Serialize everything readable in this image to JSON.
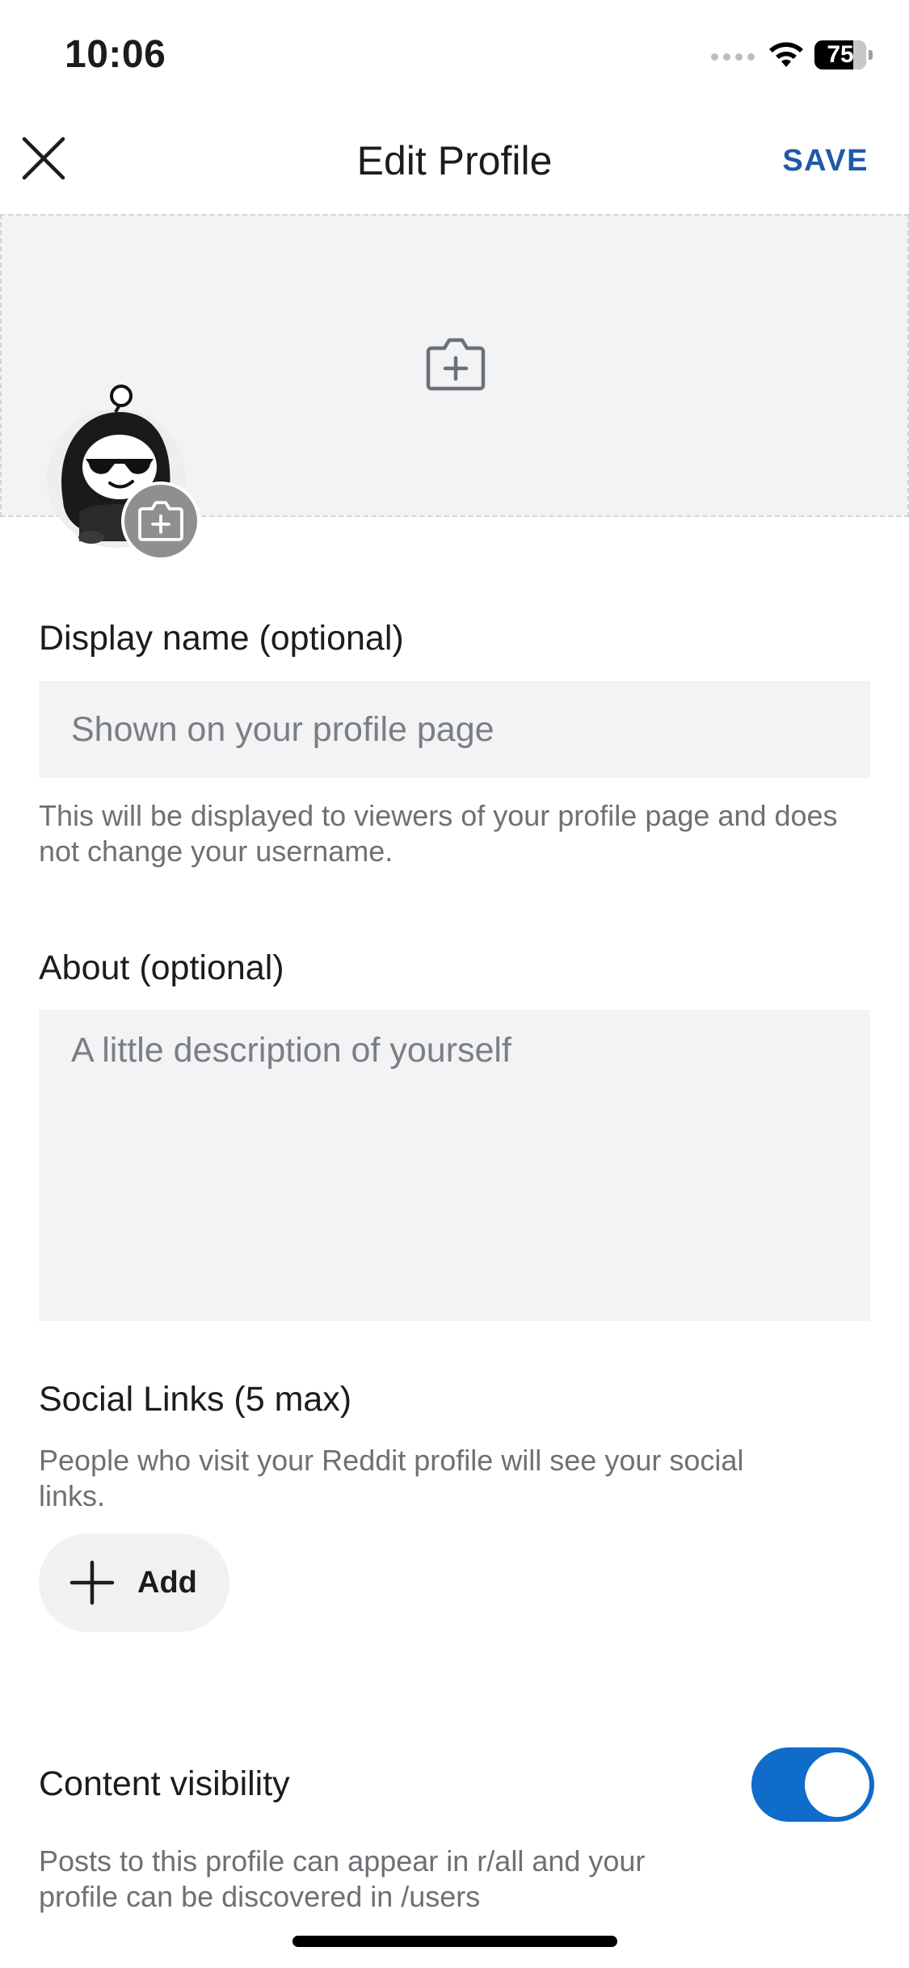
{
  "status_bar": {
    "time": "10:06",
    "battery": "75",
    "battery_level_percent": 75
  },
  "header": {
    "title": "Edit Profile",
    "save_label": "SAVE"
  },
  "display_name": {
    "label": "Display name (optional)",
    "placeholder": "Shown on your profile page",
    "value": "",
    "helper": "This will be displayed to viewers of your profile page and does not change your username."
  },
  "about": {
    "label": "About (optional)",
    "placeholder": "A little description of yourself",
    "value": ""
  },
  "social_links": {
    "label": "Social Links (5 max)",
    "helper": "People who visit your Reddit profile will see your social links.",
    "add_label": "Add"
  },
  "content_visibility": {
    "label": "Content visibility",
    "helper": "Posts to this profile can appear in r/all and your profile can be discovered in /users",
    "enabled": true
  },
  "icons": {
    "close": "close-icon",
    "banner_camera": "camera-plus-icon",
    "avatar_camera": "camera-plus-icon",
    "add": "plus-icon",
    "wifi": "wifi-icon"
  },
  "colors": {
    "accent": "#1e5aa8",
    "toggle_on": "#0f6cc8",
    "field_bg": "#f2f3f4",
    "helper_text": "#6d7074"
  }
}
